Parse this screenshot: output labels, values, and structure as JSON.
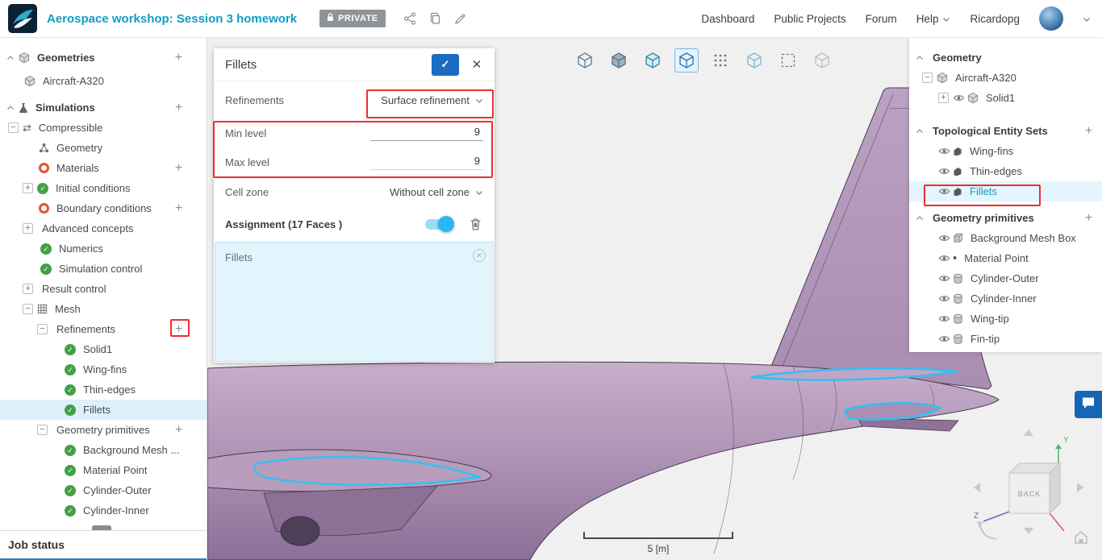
{
  "header": {
    "title": "Aerospace workshop: Session 3 homework",
    "privacy": "PRIVATE",
    "nav": {
      "dashboard": "Dashboard",
      "public_projects": "Public Projects",
      "forum": "Forum",
      "help": "Help",
      "username": "Ricardopg"
    }
  },
  "toolbar": {
    "buttons": [
      {
        "name": "view-isometric",
        "style": "outline",
        "active": false
      },
      {
        "name": "view-shaded",
        "style": "solid",
        "active": false
      },
      {
        "name": "view-shaded-edges",
        "style": "teal",
        "active": false
      },
      {
        "name": "view-solid",
        "style": "active",
        "active": true
      },
      {
        "name": "view-vertices",
        "style": "dots",
        "active": false
      },
      {
        "name": "view-transparent",
        "style": "pale-teal",
        "active": false
      },
      {
        "name": "box-select",
        "style": "dashed",
        "active": false
      },
      {
        "name": "view-mesh-off",
        "style": "pale",
        "active": false
      }
    ]
  },
  "left_tree": {
    "rows": [
      {
        "label": "Geometries",
        "pad": 8,
        "caret": true,
        "icons": [
          "cube"
        ],
        "plus": true,
        "bold": true
      },
      {
        "label": "Aircraft-A320",
        "pad": 30,
        "icons": [
          "cube"
        ],
        "margin": 4
      },
      {
        "label": "Simulations",
        "pad": 8,
        "caret": true,
        "icons": [
          "flask"
        ],
        "plus": true,
        "bold": true,
        "margin": 8
      },
      {
        "label": "Compressible",
        "pad": 10,
        "expander": "minus",
        "icons": [
          "swap"
        ]
      },
      {
        "label": "Geometry",
        "pad": 48,
        "icons": [
          "molecule"
        ]
      },
      {
        "label": "Materials",
        "pad": 48,
        "icons": [
          "ring"
        ],
        "plus": true
      },
      {
        "label": "Initial conditions",
        "pad": 28,
        "expander": "plus",
        "icons": [
          "check"
        ]
      },
      {
        "label": "Boundary conditions",
        "pad": 48,
        "icons": [
          "ring"
        ],
        "plus": true
      },
      {
        "label": "Advanced concepts",
        "pad": 28,
        "expander": "plus"
      },
      {
        "label": "Numerics",
        "pad": 50,
        "icons": [
          "check"
        ]
      },
      {
        "label": "Simulation control",
        "pad": 50,
        "icons": [
          "check"
        ]
      },
      {
        "label": "Result control",
        "pad": 28,
        "expander": "plus"
      },
      {
        "label": "Mesh",
        "pad": 28,
        "expander": "minus",
        "icons": [
          "mesh"
        ]
      },
      {
        "label": "Refinements",
        "pad": 46,
        "expander": "minus",
        "plus": true
      },
      {
        "label": "Solid1",
        "pad": 80,
        "icons": [
          "check"
        ]
      },
      {
        "label": "Wing-fins",
        "pad": 80,
        "icons": [
          "check"
        ]
      },
      {
        "label": "Thin-edges",
        "pad": 80,
        "icons": [
          "check"
        ]
      },
      {
        "label": "Fillets",
        "pad": 80,
        "icons": [
          "check"
        ],
        "selected": true
      },
      {
        "label": "Geometry primitives",
        "pad": 46,
        "expander": "minus",
        "plus": true
      },
      {
        "label": "Background Mesh ...",
        "pad": 80,
        "icons": [
          "check"
        ]
      },
      {
        "label": "Material Point",
        "pad": 80,
        "icons": [
          "check"
        ]
      },
      {
        "label": "Cylinder-Outer",
        "pad": 80,
        "icons": [
          "check"
        ]
      },
      {
        "label": "Cylinder-Inner",
        "pad": 80,
        "icons": [
          "check"
        ]
      }
    ]
  },
  "right_tree": {
    "rows": [
      {
        "label": "Geometry",
        "pad": 8,
        "caret": true,
        "bold": true
      },
      {
        "label": "Aircraft-A320",
        "pad": 16,
        "expander": "minus",
        "icons": [
          "cube"
        ]
      },
      {
        "label": "Solid1",
        "pad": 36,
        "expander": "plus",
        "icons": [
          "eye",
          "cube"
        ]
      },
      {
        "label": "Topological Entity Sets",
        "pad": 8,
        "caret": true,
        "plus": true,
        "bold": true,
        "margin": 16
      },
      {
        "label": "Wing-fins",
        "pad": 36,
        "icons": [
          "eye",
          "faces"
        ]
      },
      {
        "label": "Thin-edges",
        "pad": 36,
        "icons": [
          "eye",
          "faces"
        ]
      },
      {
        "label": "Fillets",
        "pad": 36,
        "icons": [
          "eye",
          "faces"
        ],
        "selected": true,
        "teal": true
      },
      {
        "label": "Geometry primitives",
        "pad": 8,
        "caret": true,
        "plus": true,
        "bold": true,
        "margin": 8
      },
      {
        "label": "Background Mesh Box",
        "pad": 36,
        "icons": [
          "eye",
          "box3d"
        ]
      },
      {
        "label": "Material Point",
        "pad": 36,
        "icons": [
          "eye",
          "dot"
        ]
      },
      {
        "label": "Cylinder-Outer",
        "pad": 36,
        "icons": [
          "eye",
          "cylinder"
        ]
      },
      {
        "label": "Cylinder-Inner",
        "pad": 36,
        "icons": [
          "eye",
          "cylinder"
        ]
      },
      {
        "label": "Wing-tip",
        "pad": 36,
        "icons": [
          "eye",
          "cylinder"
        ]
      },
      {
        "label": "Fin-tip",
        "pad": 36,
        "icons": [
          "eye",
          "cylinder"
        ]
      }
    ]
  },
  "panel": {
    "title": "Fillets",
    "refinements_label": "Refinements",
    "refinements_value": "Surface refinement",
    "min_label": "Min level",
    "min_value": "9",
    "max_label": "Max level",
    "max_value": "9",
    "cell_zone_label": "Cell zone",
    "cell_zone_value": "Without cell zone",
    "assignment_label": "Assignment (17 Faces )",
    "assignment_chip": "Fillets"
  },
  "viewport": {
    "scale_label": "5 [m]",
    "nav_cube_face": "BACK"
  },
  "job_status": {
    "label": "Job status"
  },
  "accent_colors": {
    "brand_teal": "#0f9dc9",
    "selection_blue": "#ddf1fb",
    "annotation_red": "#ef2d2d",
    "toggle_blue": "#29b6f6",
    "apply_blue": "#1a6dc0"
  }
}
